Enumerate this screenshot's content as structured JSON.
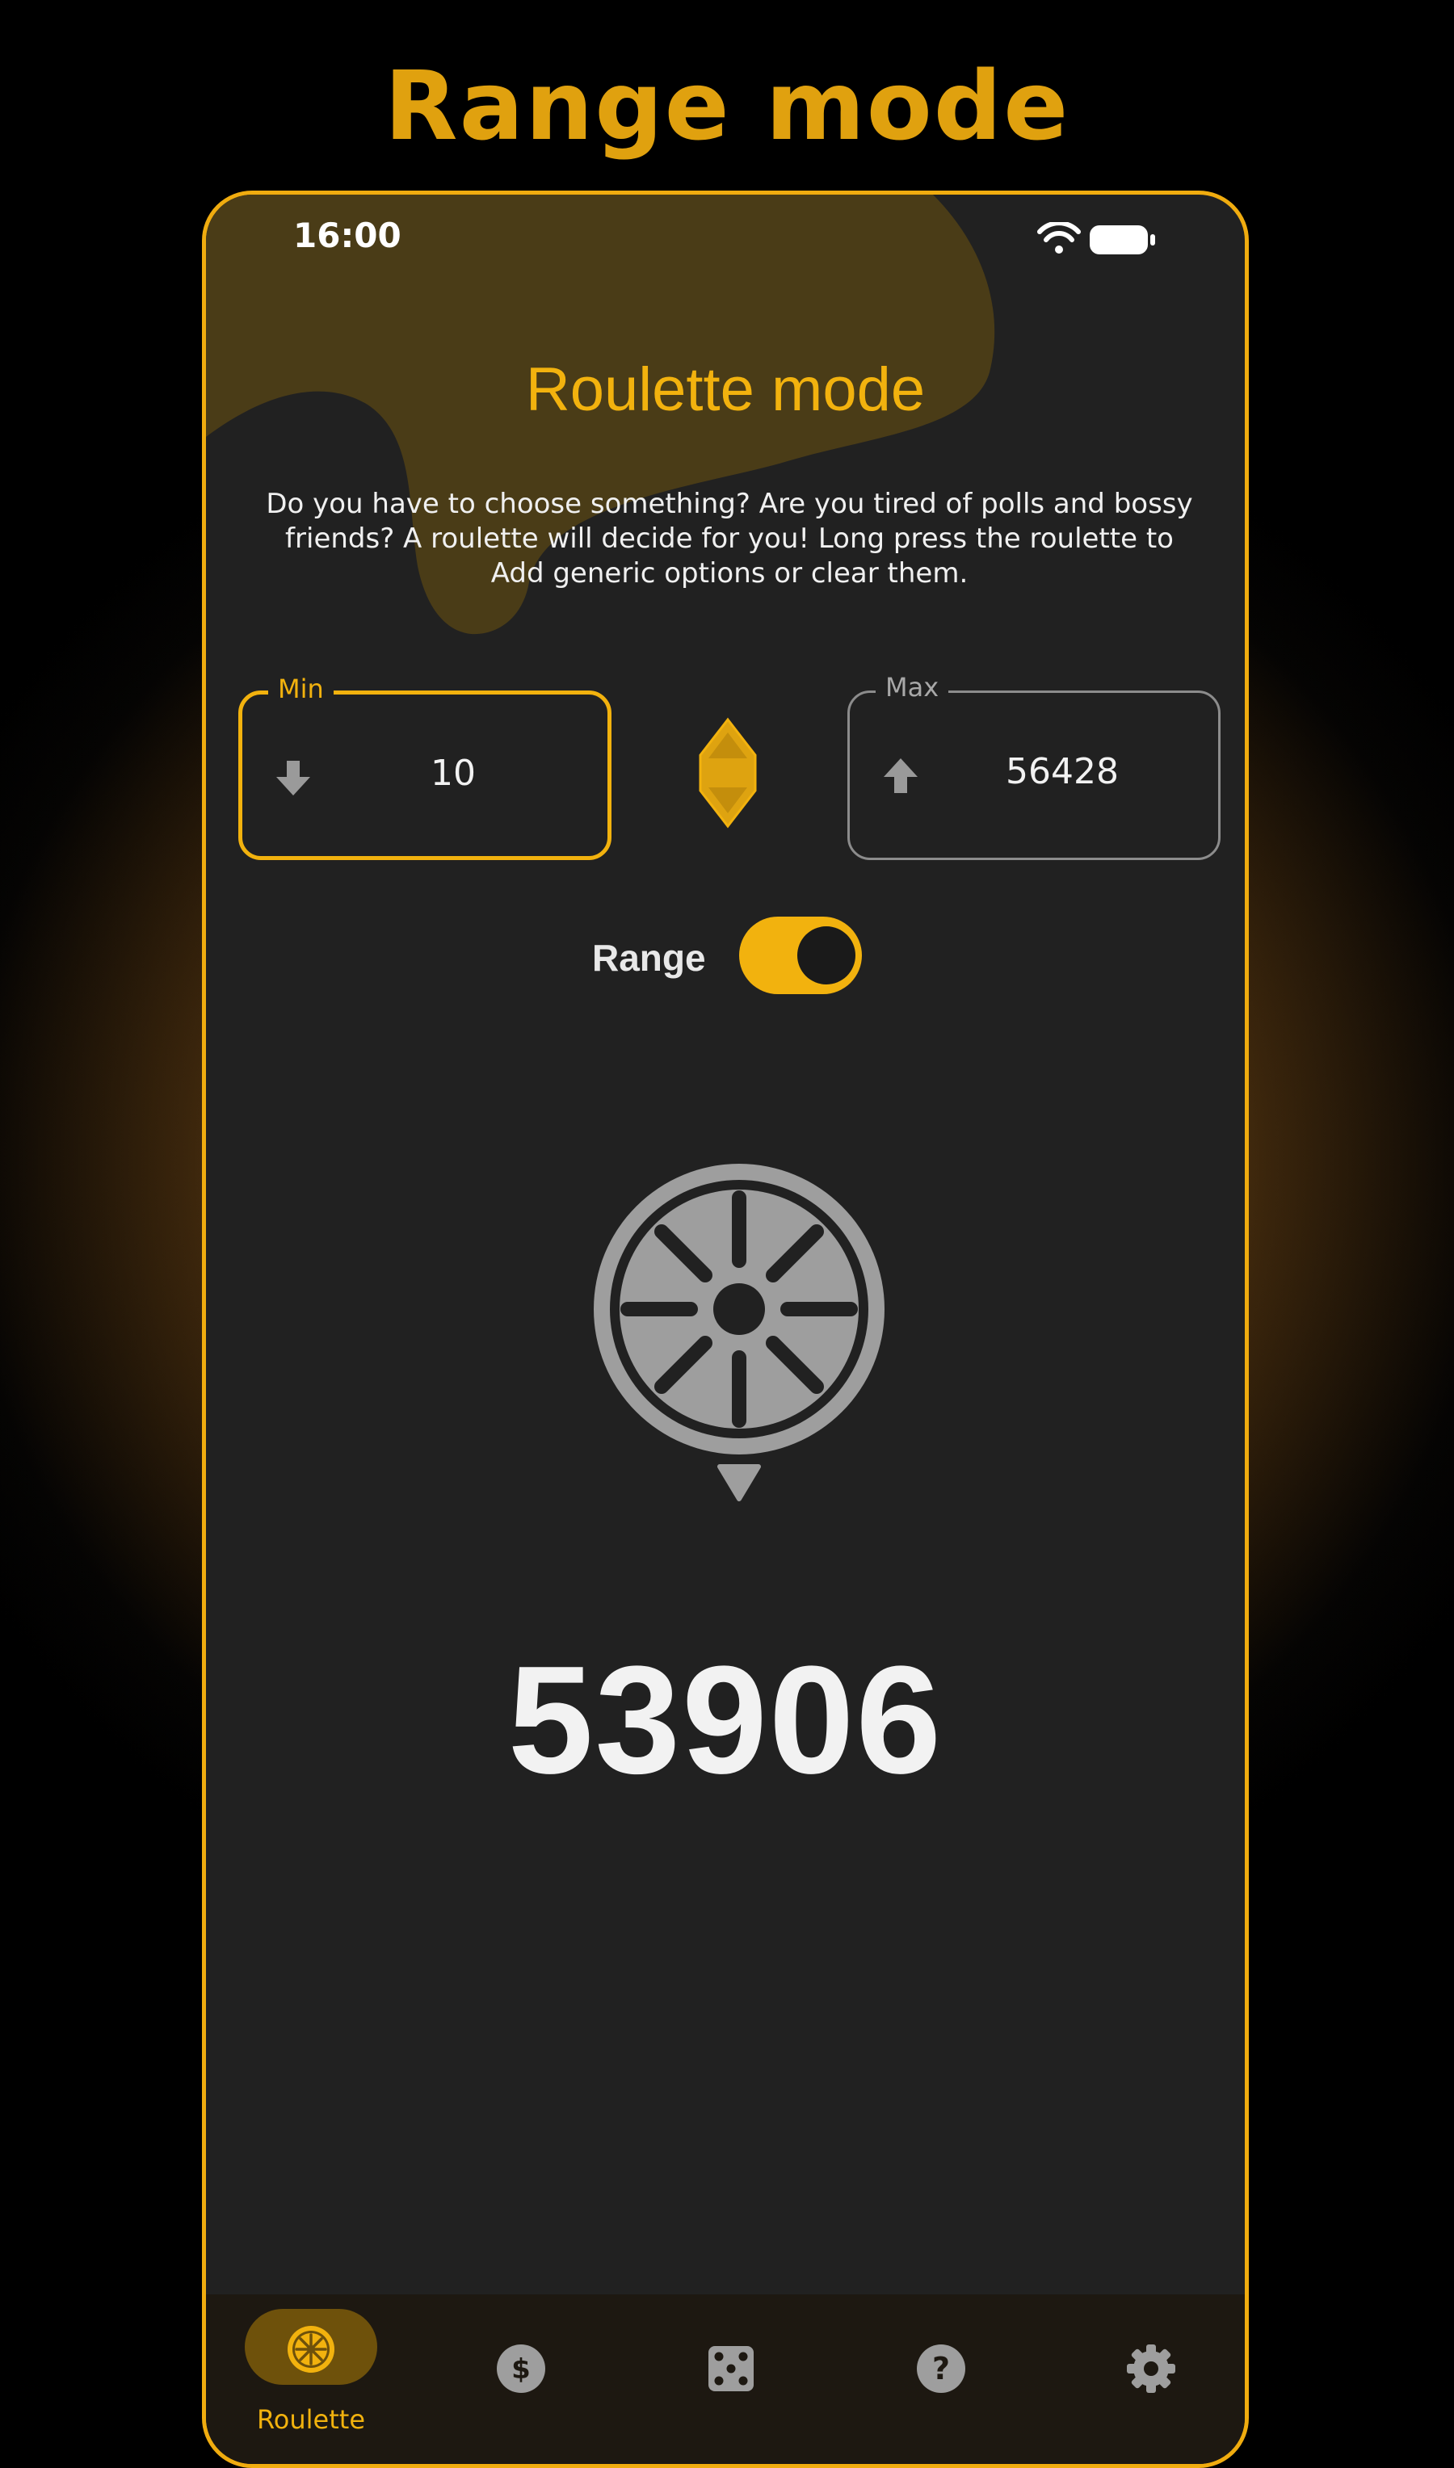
{
  "banner": {
    "title": "Range mode"
  },
  "status_bar": {
    "time": "16:00",
    "icons": [
      "wifi-icon",
      "battery-icon"
    ]
  },
  "screen": {
    "title": "Roulette mode",
    "description": "Do you have to choose something? Are you tired of polls and bossy friends? A roulette will decide for you! Long press the roulette to Add generic options or clear them."
  },
  "range": {
    "min": {
      "label": "Min",
      "value": "10",
      "icon": "arrow-down-icon"
    },
    "max": {
      "label": "Max",
      "value": "56428",
      "icon": "arrow-up-icon"
    },
    "swap_icon": "swap-diamond-icon",
    "toggle_label": "Range",
    "toggle_on": true
  },
  "wheel_icon": "roulette-wheel-icon",
  "result": "53906",
  "bottom_nav": {
    "items": [
      {
        "label": "Roulette",
        "icon": "roulette-icon",
        "active": true
      },
      {
        "label": "",
        "icon": "coin-icon",
        "active": false
      },
      {
        "label": "",
        "icon": "dice-icon",
        "active": false
      },
      {
        "label": "",
        "icon": "help-icon",
        "active": false
      },
      {
        "label": "",
        "icon": "settings-icon",
        "active": false
      }
    ]
  },
  "colors": {
    "accent": "#f2b20e",
    "banner_title": "#e0a10f",
    "background": "#212121",
    "nav_background": "#1d1811",
    "active_pill": "#6e510b",
    "muted": "#9e9e9e"
  }
}
